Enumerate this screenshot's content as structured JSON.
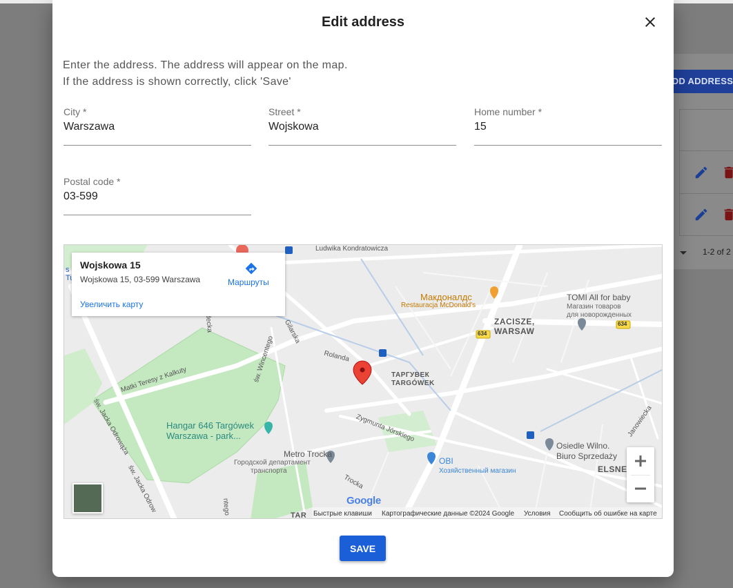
{
  "background": {
    "add_button_label": "ADD ADDRESS",
    "pagination_text": "1-2 of 2"
  },
  "dialog": {
    "title": "Edit address",
    "instructions": [
      "Enter the address. The address will appear on the map.",
      "If the address is shown correctly, click 'Save'"
    ],
    "fields": {
      "city": {
        "label": "City *",
        "value": "Warszawa"
      },
      "street": {
        "label": "Street *",
        "value": "Wojskowa"
      },
      "home_number": {
        "label": "Home number *",
        "value": "15"
      },
      "postal_code": {
        "label": "Postal code *",
        "value": "03-599"
      }
    },
    "save_label": "SAVE"
  },
  "map": {
    "info_card": {
      "title": "Wojskowa 15",
      "address": "Wojskowa 15, 03-599 Warszawa",
      "enlarge_link": "Увеличить карту",
      "routes_label": "Маршруты"
    },
    "labels": {
      "kondratowicza": "Ludwika Kondratowicza",
      "mcd_name": "Макдоналдс",
      "mcd_sub": "Restauracja McDonald's",
      "tomi_name": "TOMI All for baby",
      "tomi_sub1": "Магазин товаров",
      "tomi_sub2": "для новорожденных",
      "zacisze1": "ZACISZE,",
      "zacisze2": "WARSAW",
      "targowek_cyr": "ТАРГУВЕК",
      "targowek": "TARGÓWEK",
      "hangar1": "Hangar 646 Targówek",
      "hangar2": "Warszawa - park...",
      "metro1": "Metro Trocka",
      "metro2": "Городской департамент",
      "metro3": "транспорта",
      "obi1": "OBI",
      "obi2": "Хозяйственный магазин",
      "osiedle1": "Osiedle Wilno.",
      "osiedle2": "Biuro Sprzedaży",
      "elsner": "ELSNE",
      "matki": "Matki Teresy z Kalkuty",
      "wincentego": "św. Wincentego",
      "gilarska": "Gilarska",
      "rolanda": "Rolanda",
      "zygmunta": "Zygmunta Jórskiego",
      "trocka": "Trocka",
      "odrowaza1": "św. Jacka Odrowąża",
      "odrowaza2": "św. Jacka Odrow",
      "janowiecka": "Janowiecka",
      "route634": "634",
      "partial_left": "Tu",
      "partial_left2": "s",
      "partial_decka": "decka",
      "partial_ntego": "ntego",
      "partial_tar": "TAR"
    },
    "google_logo": "Google",
    "attribution": {
      "shortcuts": "Быстрые клавиши",
      "map_data": "Картографические данные ©2024 Google",
      "terms": "Условия",
      "report": "Сообщить об ошибке на карте"
    }
  },
  "colors": {
    "primary": "#1a5fd8",
    "delete_red": "#7a1414",
    "marker_red": "#ea4335",
    "park_green": "#c4e8c0"
  }
}
